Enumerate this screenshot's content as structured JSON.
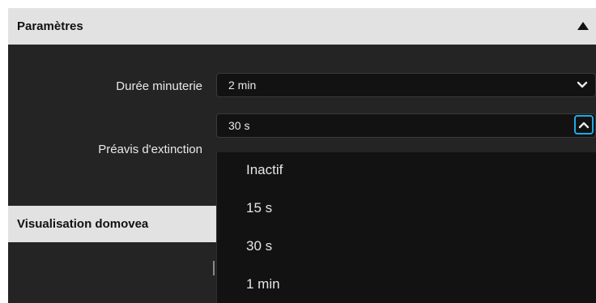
{
  "settings": {
    "title": "Paramètres",
    "timer": {
      "label": "Durée minuterie",
      "value": "2 min"
    },
    "shutdown_warning": {
      "label": "Préavis d'extinction",
      "value": "30 s",
      "options": [
        "Inactif",
        "15 s",
        "30 s",
        "1 min"
      ]
    }
  },
  "visualisation": {
    "title": "Visualisation domovea"
  },
  "colors": {
    "accent": "#22a8e6",
    "panel_bg": "#242424",
    "header_bg": "#e2e2e2",
    "field_bg": "#121212"
  },
  "icons": {
    "collapse": "triangle-up-icon",
    "dropdown": "chevron-down-icon",
    "dropdown_open": "chevron-up-icon"
  }
}
